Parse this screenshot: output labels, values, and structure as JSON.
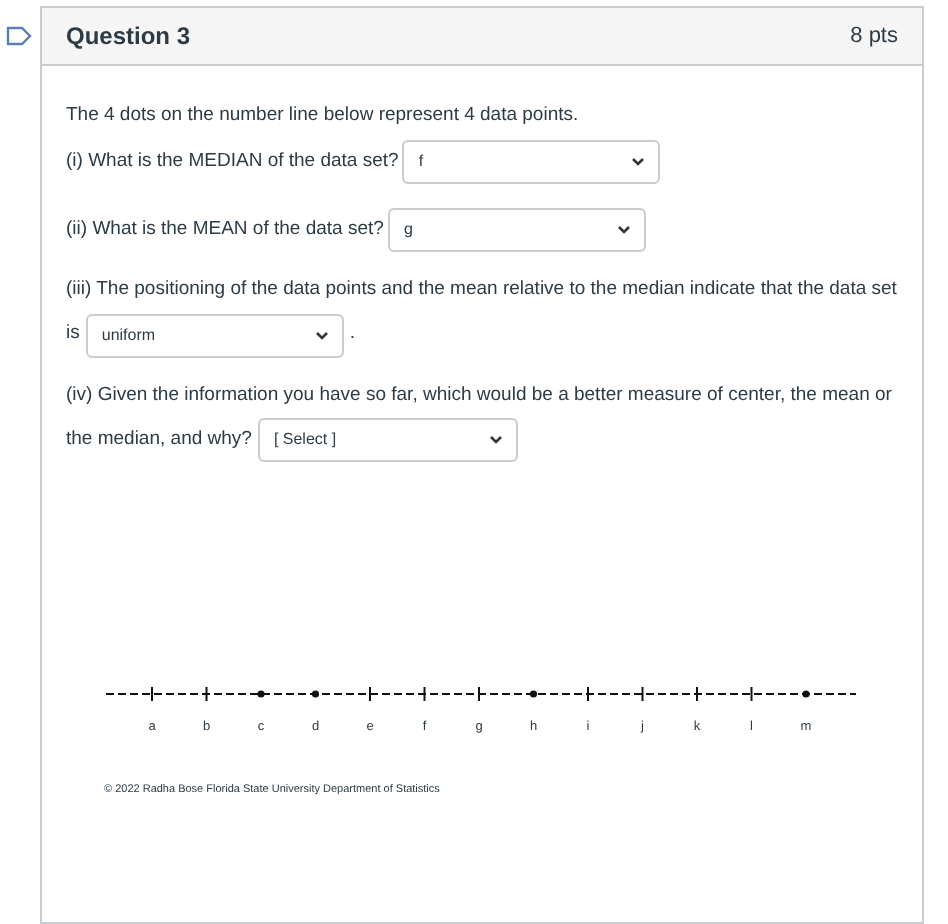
{
  "question": {
    "title": "Question 3",
    "points": "8 pts"
  },
  "intro": "The 4 dots on the number line below represent 4 data points.",
  "parts": [
    {
      "kind": "inline",
      "before": "(i) What is the MEDIAN of the data set?",
      "value": "f"
    },
    {
      "kind": "inline",
      "before": "(ii) What is the MEAN of the data set?",
      "value": "g"
    },
    {
      "kind": "wrapped",
      "before": "(iii) The positioning of the data points and the mean relative to the median indicate that the data set",
      "lead": "is",
      "value": "uniform",
      "after": "."
    },
    {
      "kind": "wrapped",
      "before": "(iv) Given the information you have so far, which would be a better measure of center, the mean or",
      "lead": "the median, and why?",
      "value": "[ Select ]"
    }
  ],
  "number_line": {
    "points": [
      {
        "label": "a",
        "dot": false
      },
      {
        "label": "b",
        "dot": false
      },
      {
        "label": "c",
        "dot": true
      },
      {
        "label": "d",
        "dot": true
      },
      {
        "label": "e",
        "dot": false
      },
      {
        "label": "f",
        "dot": false
      },
      {
        "label": "g",
        "dot": false
      },
      {
        "label": "h",
        "dot": true
      },
      {
        "label": "i",
        "dot": false
      },
      {
        "label": "j",
        "dot": false
      },
      {
        "label": "k",
        "dot": false
      },
      {
        "label": "l",
        "dot": false
      },
      {
        "label": "m",
        "dot": true
      }
    ],
    "copyright": "© 2022 Radha Bose Florida State University Department of Statistics"
  }
}
